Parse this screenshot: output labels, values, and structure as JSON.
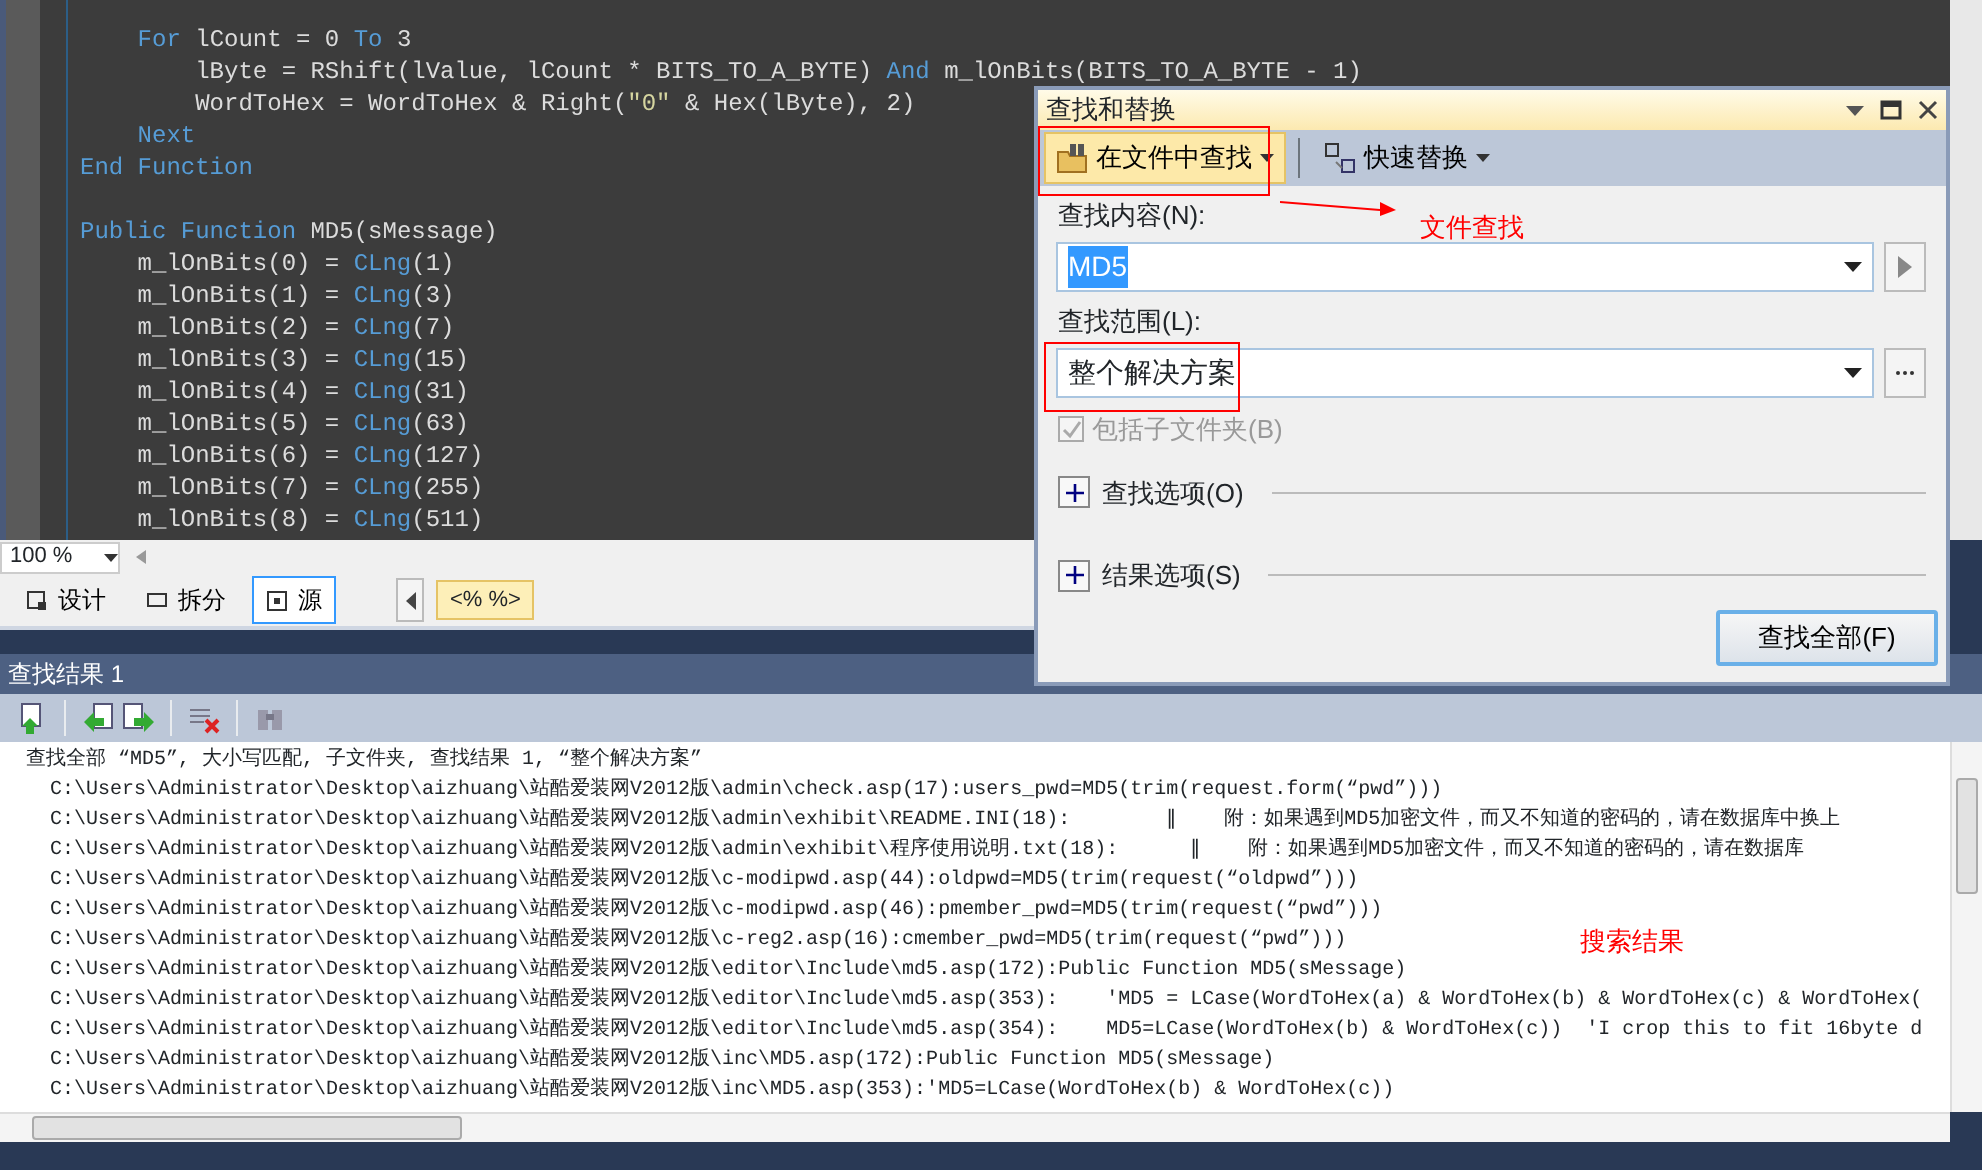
{
  "editor": {
    "blocks": [
      {
        "lines": [
          [
            {
              "t": "    For",
              "kind": "kw"
            },
            {
              "t": " lCount = 0 ",
              "kind": "plain"
            },
            {
              "t": "To",
              "kind": "kw"
            },
            {
              "t": " 3",
              "kind": "plain"
            }
          ],
          [
            {
              "t": "        lByte = RShift(lValue, lCount * BITS_TO_A_BYTE) ",
              "kind": "plain"
            },
            {
              "t": "And",
              "kind": "kw"
            },
            {
              "t": " m_lOnBits(BITS_TO_A_BYTE - 1)",
              "kind": "plain"
            }
          ],
          [
            {
              "t": "        WordToHex = WordToHex & Right(",
              "kind": "plain"
            },
            {
              "t": "\"0\"",
              "kind": "str"
            },
            {
              "t": " & Hex(lByte), 2)",
              "kind": "plain"
            }
          ],
          [
            {
              "t": "    Next",
              "kind": "kw"
            }
          ],
          [
            {
              "t": "End Function",
              "kind": "kw"
            }
          ]
        ]
      },
      {
        "lines": [
          [
            {
              "t": "Public Function",
              "kind": "kw"
            },
            {
              "t": " MD5(sMessage)",
              "kind": "plain"
            }
          ],
          [
            {
              "t": "    m_lOnBits(0) = ",
              "kind": "plain"
            },
            {
              "t": "CLng",
              "kind": "kw"
            },
            {
              "t": "(1)",
              "kind": "plain"
            }
          ],
          [
            {
              "t": "    m_lOnBits(1) = ",
              "kind": "plain"
            },
            {
              "t": "CLng",
              "kind": "kw"
            },
            {
              "t": "(3)",
              "kind": "plain"
            }
          ],
          [
            {
              "t": "    m_lOnBits(2) = ",
              "kind": "plain"
            },
            {
              "t": "CLng",
              "kind": "kw"
            },
            {
              "t": "(7)",
              "kind": "plain"
            }
          ],
          [
            {
              "t": "    m_lOnBits(3) = ",
              "kind": "plain"
            },
            {
              "t": "CLng",
              "kind": "kw"
            },
            {
              "t": "(15)",
              "kind": "plain"
            }
          ],
          [
            {
              "t": "    m_lOnBits(4) = ",
              "kind": "plain"
            },
            {
              "t": "CLng",
              "kind": "kw"
            },
            {
              "t": "(31)",
              "kind": "plain"
            }
          ],
          [
            {
              "t": "    m_lOnBits(5) = ",
              "kind": "plain"
            },
            {
              "t": "CLng",
              "kind": "kw"
            },
            {
              "t": "(63)",
              "kind": "plain"
            }
          ],
          [
            {
              "t": "    m_lOnBits(6) = ",
              "kind": "plain"
            },
            {
              "t": "CLng",
              "kind": "kw"
            },
            {
              "t": "(127)",
              "kind": "plain"
            }
          ],
          [
            {
              "t": "    m_lOnBits(7) = ",
              "kind": "plain"
            },
            {
              "t": "CLng",
              "kind": "kw"
            },
            {
              "t": "(255)",
              "kind": "plain"
            }
          ],
          [
            {
              "t": "    m_lOnBits(8) = ",
              "kind": "plain"
            },
            {
              "t": "CLng",
              "kind": "kw"
            },
            {
              "t": "(511)",
              "kind": "plain"
            }
          ]
        ]
      }
    ]
  },
  "zoom": "100 %",
  "view_tabs": [
    {
      "label": "设计",
      "selected": false
    },
    {
      "label": "拆分",
      "selected": false
    },
    {
      "label": "源",
      "selected": true
    }
  ],
  "tag_crumb": "<% %>",
  "find_dialog": {
    "title": "查找和替换",
    "modes": [
      {
        "label": "在文件中查找",
        "selected": true
      },
      {
        "label": "快速替换",
        "selected": false
      }
    ],
    "find_label": "查找内容(N):",
    "find_value": "MD5",
    "scope_label": "查找范围(L):",
    "scope_value": "整个解决方案",
    "include_subfolders": {
      "label": "包括子文件夹(B)",
      "checked": true,
      "disabled": true
    },
    "sections": [
      {
        "label": "查找选项(O)",
        "expanded": false
      },
      {
        "label": "结果选项(S)",
        "expanded": false
      }
    ],
    "button": "查找全部(F)"
  },
  "annotations": [
    {
      "text": "文件查找"
    },
    {
      "text": "搜索结果"
    }
  ],
  "results": {
    "title": "查找结果 1",
    "summary": "查找全部 “MD5”, 大小写匹配, 子文件夹, 查找结果 1, “整个解决方案”",
    "lines": [
      "C:\\Users\\Administrator\\Desktop\\aizhuang\\站酷爱装网V2012版\\admin\\check.asp(17):users_pwd=MD5(trim(request.form(“pwd”)))",
      "C:\\Users\\Administrator\\Desktop\\aizhuang\\站酷爱装网V2012版\\admin\\exhibit\\README.INI(18):        ‖    附：如果遇到MD5加密文件，而又不知道的密码的，请在数据库中换上",
      "C:\\Users\\Administrator\\Desktop\\aizhuang\\站酷爱装网V2012版\\admin\\exhibit\\程序使用说明.txt(18):      ‖    附：如果遇到MD5加密文件，而又不知道的密码的，请在数据库",
      "C:\\Users\\Administrator\\Desktop\\aizhuang\\站酷爱装网V2012版\\c-modipwd.asp(44):oldpwd=MD5(trim(request(“oldpwd”)))",
      "C:\\Users\\Administrator\\Desktop\\aizhuang\\站酷爱装网V2012版\\c-modipwd.asp(46):pmember_pwd=MD5(trim(request(“pwd”)))",
      "C:\\Users\\Administrator\\Desktop\\aizhuang\\站酷爱装网V2012版\\c-reg2.asp(16):cmember_pwd=MD5(trim(request(“pwd”)))",
      "C:\\Users\\Administrator\\Desktop\\aizhuang\\站酷爱装网V2012版\\editor\\Include\\md5.asp(172):Public Function MD5(sMessage)",
      "C:\\Users\\Administrator\\Desktop\\aizhuang\\站酷爱装网V2012版\\editor\\Include\\md5.asp(353):    'MD5 = LCase(WordToHex(a) & WordToHex(b) & WordToHex(c) & WordToHex(",
      "C:\\Users\\Administrator\\Desktop\\aizhuang\\站酷爱装网V2012版\\editor\\Include\\md5.asp(354):    MD5=LCase(WordToHex(b) & WordToHex(c))  'I crop this to fit 16byte d",
      "C:\\Users\\Administrator\\Desktop\\aizhuang\\站酷爱装网V2012版\\inc\\MD5.asp(172):Public Function MD5(sMessage)",
      "C:\\Users\\Administrator\\Desktop\\aizhuang\\站酷爱装网V2012版\\inc\\MD5.asp(353):'MD5=LCase(WordToHex(b) & WordToHex(c))"
    ]
  }
}
